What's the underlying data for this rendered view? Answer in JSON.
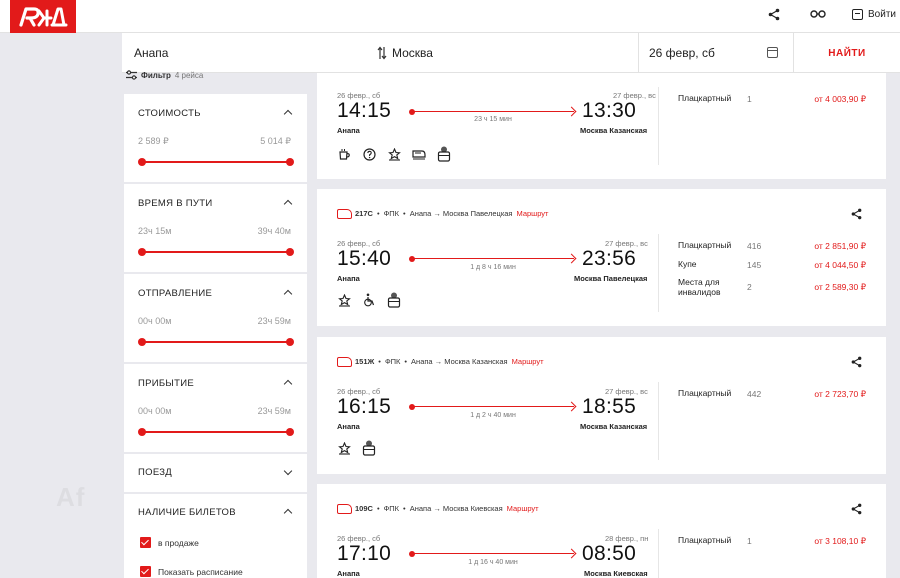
{
  "header": {
    "logo_text": "РЖД",
    "share_icon": "share-icon",
    "glasses_icon": "glasses-icon",
    "login_label": "Войти"
  },
  "search": {
    "from": "Анапа",
    "to": "Москва",
    "date": "26 февр, сб",
    "find_label": "НАЙТИ"
  },
  "filter": {
    "label": "Фильтр",
    "count": "4 рейса",
    "blocks": [
      {
        "title": "СТОИМОСТЬ",
        "min": "2 589 ₽",
        "max": "5 014 ₽",
        "expanded": true
      },
      {
        "title": "ВРЕМЯ В ПУТИ",
        "min": "23ч 15м",
        "max": "39ч 40м",
        "expanded": true
      },
      {
        "title": "ОТПРАВЛЕНИЕ",
        "min": "00ч 00м",
        "max": "23ч 59м",
        "expanded": true
      },
      {
        "title": "ПРИБЫТИЕ",
        "min": "00ч 00м",
        "max": "23ч 59м",
        "expanded": true
      },
      {
        "title": "ПОЕЗД",
        "expanded": false
      },
      {
        "title": "НАЛИЧИЕ БИЛЕТОВ",
        "expanded": true
      }
    ],
    "tickets_options": [
      {
        "label": "в продаже",
        "checked": true
      },
      {
        "label": "Показать расписание",
        "checked": true
      }
    ]
  },
  "trains": [
    {
      "number": "",
      "carrier": "",
      "route": "",
      "route_link": "",
      "dep_date": "26 февр., сб",
      "arr_date": "27 февр., вс",
      "dep_time": "14:15",
      "arr_time": "13:30",
      "dep_station": "Анапа",
      "arr_station": "Москва Казанская",
      "duration": "23 ч 15 мин",
      "icons": [
        "cup-icon",
        "help-icon",
        "star-badge-icon",
        "ticket-icon",
        "luggage-icon"
      ],
      "fares": [
        {
          "type": "Плацкартный",
          "seats": "1",
          "price": "от 4 003,90 ₽"
        }
      ]
    },
    {
      "number": "217С",
      "carrier": "ФПК",
      "route": "Анапа → Москва Павелецкая",
      "route_link": "Маршрут",
      "dep_date": "26 февр., сб",
      "arr_date": "27 февр., вс",
      "dep_time": "15:40",
      "arr_time": "23:56",
      "dep_station": "Анапа",
      "arr_station": "Москва Павелецкая",
      "duration": "1 д 8 ч 16 мин",
      "icons": [
        "star-badge-icon",
        "wheelchair-icon",
        "luggage-icon"
      ],
      "fares": [
        {
          "type": "Плацкартный",
          "seats": "416",
          "price": "от 2 851,90 ₽"
        },
        {
          "type": "Купе",
          "seats": "145",
          "price": "от 4 044,50 ₽"
        },
        {
          "type": "Места для инвалидов",
          "seats": "2",
          "price": "от 2 589,30 ₽"
        }
      ]
    },
    {
      "number": "151Ж",
      "carrier": "ФПК",
      "route": "Анапа → Москва Казанская",
      "route_link": "Маршрут",
      "dep_date": "26 февр., сб",
      "arr_date": "27 февр., вс",
      "dep_time": "16:15",
      "arr_time": "18:55",
      "dep_station": "Анапа",
      "arr_station": "Москва Казанская",
      "duration": "1 д 2 ч 40 мин",
      "icons": [
        "star-badge-icon",
        "luggage-icon"
      ],
      "fares": [
        {
          "type": "Плацкартный",
          "seats": "442",
          "price": "от 2 723,70 ₽"
        }
      ]
    },
    {
      "number": "109С",
      "carrier": "ФПК",
      "route": "Анапа → Москва Киевская",
      "route_link": "Маршрут",
      "dep_date": "26 февр., сб",
      "arr_date": "28 февр., пн",
      "dep_time": "17:10",
      "arr_time": "08:50",
      "dep_station": "Анапа",
      "arr_station": "Москва Киевская",
      "duration": "1 д 16 ч 40 мин",
      "icons": [],
      "fares": [
        {
          "type": "Плацкартный",
          "seats": "1",
          "price": "от 3 108,10 ₽"
        }
      ]
    }
  ],
  "watermark": "Af"
}
